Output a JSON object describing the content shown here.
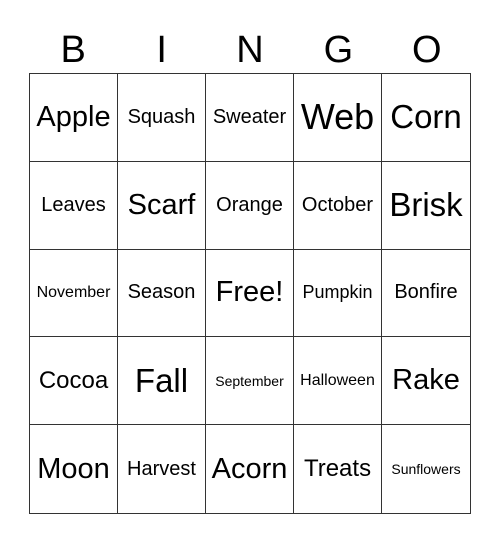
{
  "header": [
    "B",
    "I",
    "N",
    "G",
    "O"
  ],
  "cells": [
    {
      "text": "Apple",
      "size": "s28"
    },
    {
      "text": "Squash",
      "size": "s20"
    },
    {
      "text": "Sweater",
      "size": "s20"
    },
    {
      "text": "Web",
      "size": "s36"
    },
    {
      "text": "Corn",
      "size": "s32"
    },
    {
      "text": "Leaves",
      "size": "s20"
    },
    {
      "text": "Scarf",
      "size": "s28"
    },
    {
      "text": "Orange",
      "size": "s20"
    },
    {
      "text": "October",
      "size": "s20"
    },
    {
      "text": "Brisk",
      "size": "s32"
    },
    {
      "text": "November",
      "size": "s16"
    },
    {
      "text": "Season",
      "size": "s20"
    },
    {
      "text": "Free!",
      "size": "s28"
    },
    {
      "text": "Pumpkin",
      "size": "s18"
    },
    {
      "text": "Bonfire",
      "size": "s20"
    },
    {
      "text": "Cocoa",
      "size": "s24"
    },
    {
      "text": "Fall",
      "size": "s32"
    },
    {
      "text": "September",
      "size": "s14"
    },
    {
      "text": "Halloween",
      "size": "s16"
    },
    {
      "text": "Rake",
      "size": "s28"
    },
    {
      "text": "Moon",
      "size": "s28"
    },
    {
      "text": "Harvest",
      "size": "s20"
    },
    {
      "text": "Acorn",
      "size": "s28"
    },
    {
      "text": "Treats",
      "size": "s24"
    },
    {
      "text": "Sunflowers",
      "size": "s14"
    }
  ]
}
